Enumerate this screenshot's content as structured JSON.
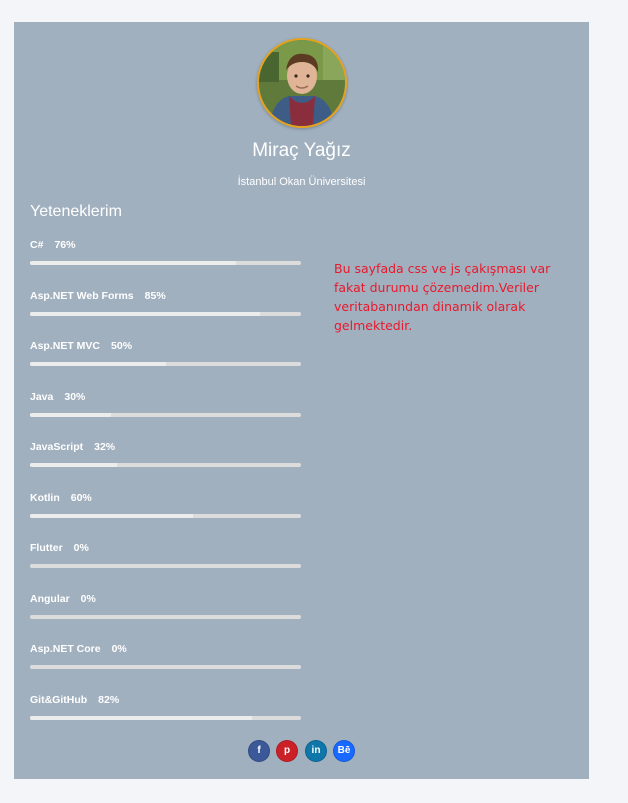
{
  "profile": {
    "name": "Miraç Yağız",
    "school": "İstanbul Okan Üniversitesi",
    "avatar_border_color": "#e6a21a"
  },
  "skills": {
    "title": "Yeteneklerim",
    "items": [
      {
        "name": "C#",
        "percent_label": "76%",
        "percent": 76
      },
      {
        "name": "Asp.NET Web Forms",
        "percent_label": "85%",
        "percent": 85
      },
      {
        "name": "Asp.NET MVC",
        "percent_label": "50%",
        "percent": 50
      },
      {
        "name": "Java",
        "percent_label": "30%",
        "percent": 30
      },
      {
        "name": "JavaScript",
        "percent_label": "32%",
        "percent": 32
      },
      {
        "name": "Kotlin",
        "percent_label": "60%",
        "percent": 60
      },
      {
        "name": "Flutter",
        "percent_label": "0%",
        "percent": 0
      },
      {
        "name": "Angular",
        "percent_label": "0%",
        "percent": 0
      },
      {
        "name": "Asp.NET Core",
        "percent_label": "0%",
        "percent": 0
      },
      {
        "name": "Git&GitHub",
        "percent_label": "82%",
        "percent": 82
      }
    ]
  },
  "notice": {
    "text": "Bu sayfada css ve js çakışması var fakat durumu çözemedim.Veriler veritabanından dinamik olarak gelmektedir.",
    "color": "#e8192c"
  },
  "socials": [
    {
      "icon": "facebook-icon",
      "glyph": "f",
      "color": "#3b5998"
    },
    {
      "icon": "pinterest-icon",
      "glyph": "p",
      "color": "#cb2027"
    },
    {
      "icon": "linkedin-icon",
      "glyph": "in",
      "color": "#0e76a8"
    },
    {
      "icon": "behance-icon",
      "glyph": "Bē",
      "color": "#1769ff"
    }
  ],
  "colors": {
    "page_background": "#f3f5f9",
    "card_background": "#a1b0bf",
    "bar_track": "#dcdcdc"
  }
}
